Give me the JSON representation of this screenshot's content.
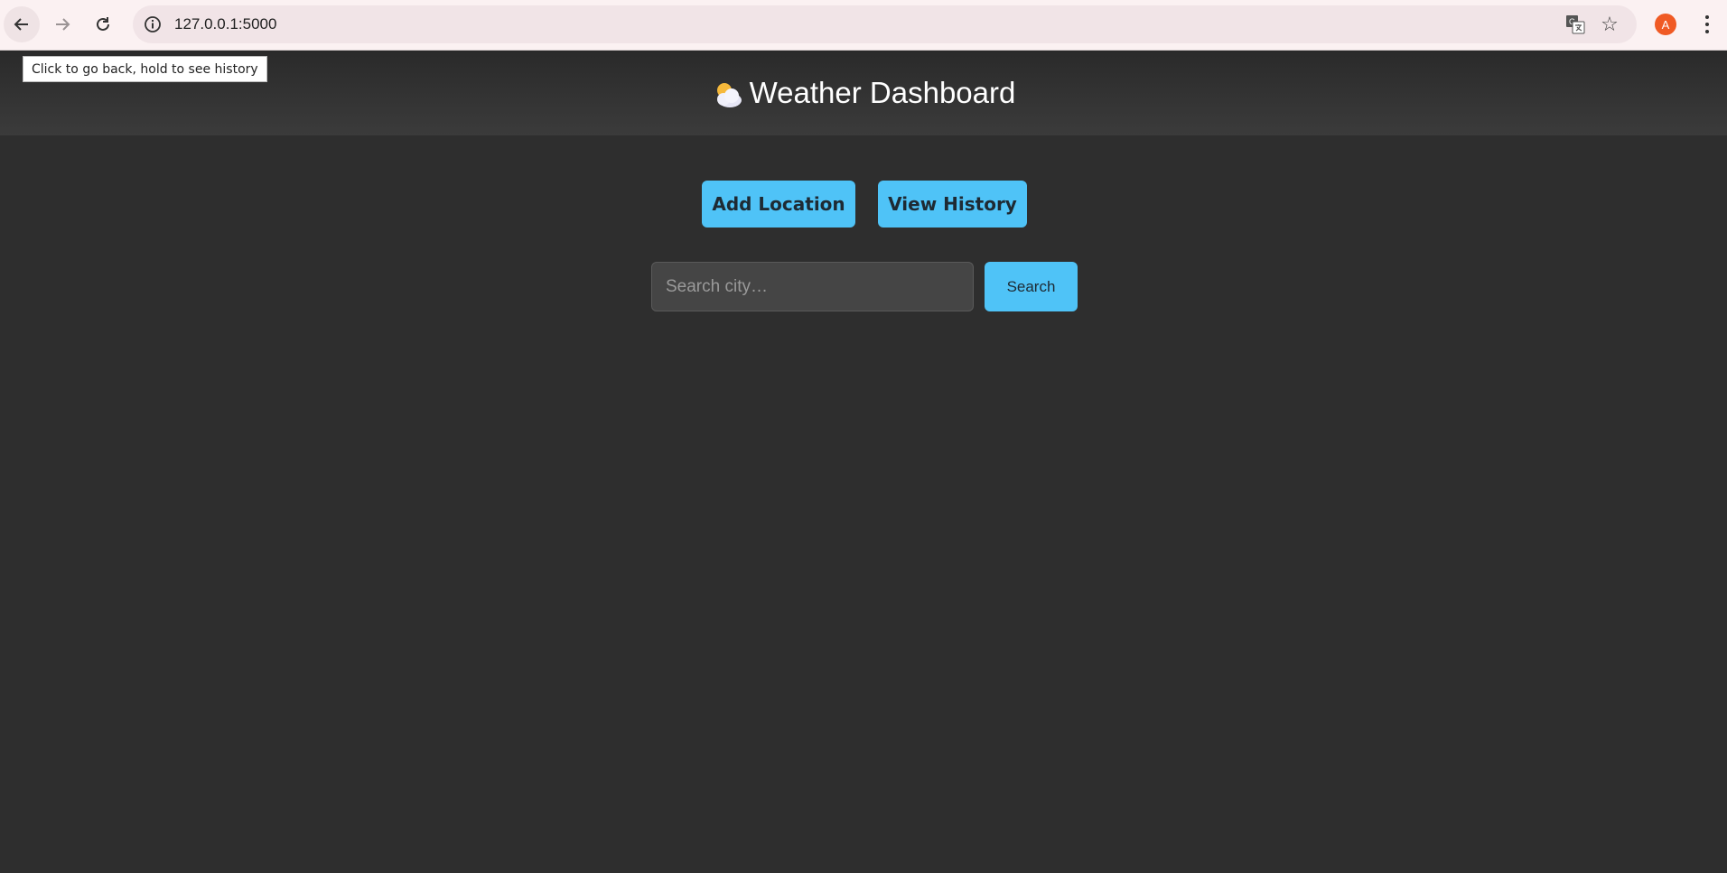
{
  "browser": {
    "url": "127.0.0.1:5000",
    "avatar_letter": "A",
    "tooltip": "Click to go back, hold to see history",
    "icons": {
      "back": "arrow-left-icon",
      "forward": "arrow-right-icon",
      "reload": "reload-icon",
      "site_info": "info-icon",
      "translate": "translate-icon",
      "bookmark": "star-icon",
      "menu": "kebab-menu-icon"
    }
  },
  "header": {
    "title": "Weather Dashboard",
    "title_icon": "sun-behind-cloud-icon"
  },
  "actions": {
    "add_location": "Add Location",
    "view_history": "View History"
  },
  "search": {
    "placeholder": "Search city…",
    "value": "",
    "button_label": "Search"
  },
  "colors": {
    "background": "#2e2e2e",
    "accent": "#4fc3f7",
    "header": "#3b3b3b",
    "avatar": "#f05a24"
  }
}
